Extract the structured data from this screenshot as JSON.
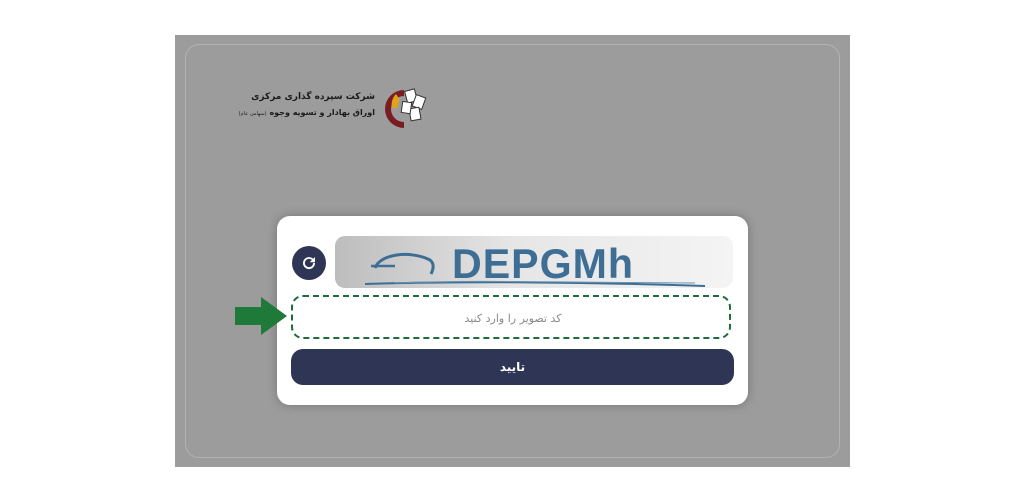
{
  "logo": {
    "line1": "شرکت سپرده گذاری مرکزی",
    "line2": "اوراق بهادار و تسویه وجوه",
    "line2_sub": "(سهامی عام)"
  },
  "captcha": {
    "text": "DEPGMh"
  },
  "code_input": {
    "placeholder": "کد تصویر را وارد کنید",
    "value": ""
  },
  "submit": {
    "label": "تایید"
  },
  "colors": {
    "primary": "#2f3655",
    "overlay": "#9c9c9c",
    "arrow": "#1f7a3a",
    "captcha_text": "#3f6e95"
  },
  "icons": {
    "refresh": "refresh-icon",
    "arrow": "arrow-right-icon"
  }
}
